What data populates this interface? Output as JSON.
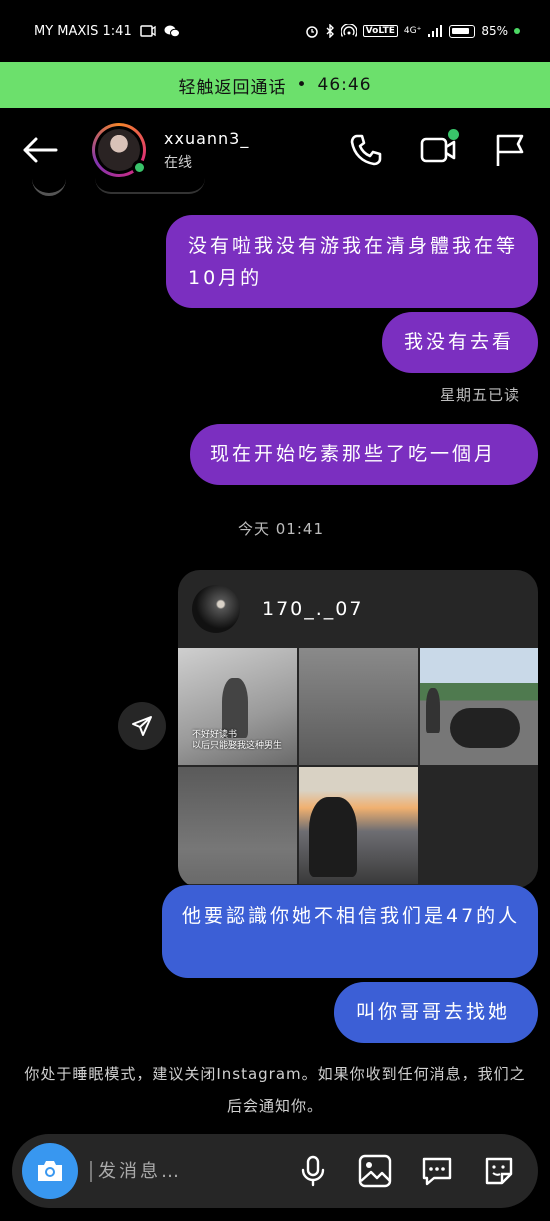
{
  "status_bar": {
    "carrier_time": "MY MAXIS 1:41",
    "network": "4G⁺",
    "volte": "VoLTE",
    "battery": "85%"
  },
  "call_banner": {
    "text": "轻触返回通话",
    "separator": "•",
    "duration": "46:46"
  },
  "header": {
    "username": "xxuann3_",
    "status": "在线"
  },
  "messages": [
    {
      "text": "没有啦我没有游我在清身體我在等10月的",
      "color": "#7b2fc0"
    },
    {
      "text": "我没有去看",
      "color": "#7b2fc0"
    },
    {
      "text": "现在开始吃素那些了吃一個月",
      "color": "#7b2fc0"
    },
    {
      "text": "他要認識你她不相信我们是47的人",
      "color": "#3c5fd6"
    },
    {
      "text": "叫你哥哥去找她",
      "color": "#3c5fd6"
    }
  ],
  "read_receipt": "星期五已读",
  "timestamp": "今天 01:41",
  "shared_post": {
    "username": "170_._07",
    "overlay_caption": "不好好读书\n以后只能娶我这种男生"
  },
  "notice": "你处于睡眠模式，建议关闭Instagram。如果你收到任何消息，我们之后会通知你。",
  "composer": {
    "placeholder": "发消息…"
  },
  "colors": {
    "accent_green": "#6ce06c",
    "online": "#39c36a",
    "camera": "#3897f0"
  }
}
